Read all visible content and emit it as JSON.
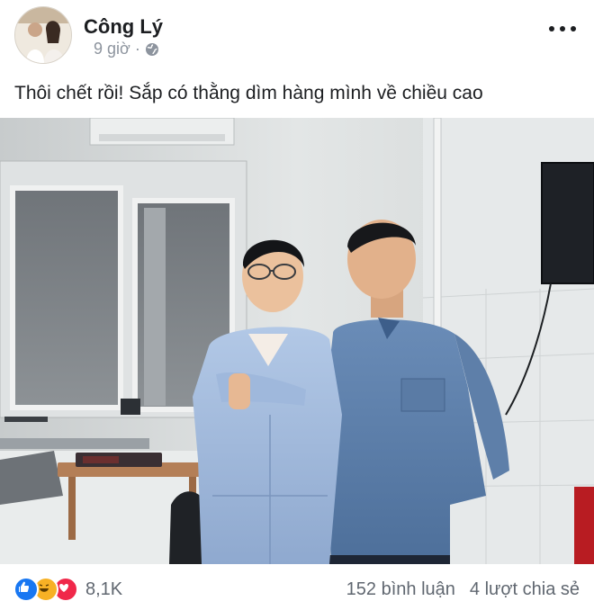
{
  "post": {
    "author": "Công Lý",
    "time": "9 giờ",
    "privacy_icon": "globe-icon",
    "text": "Thôi chết rồi! Sắp có thằng dìm hàng mình về chiều cao"
  },
  "footer": {
    "reaction_icons": [
      "like-icon",
      "haha-icon",
      "love-icon"
    ],
    "reaction_count": "8,1K",
    "comments": "152 bình luận",
    "shares": "4 lượt chia sẻ"
  },
  "colors": {
    "like": "#1877f2",
    "haha": "#f7b125",
    "love": "#f0284a",
    "secondary_text": "#8d949e"
  }
}
